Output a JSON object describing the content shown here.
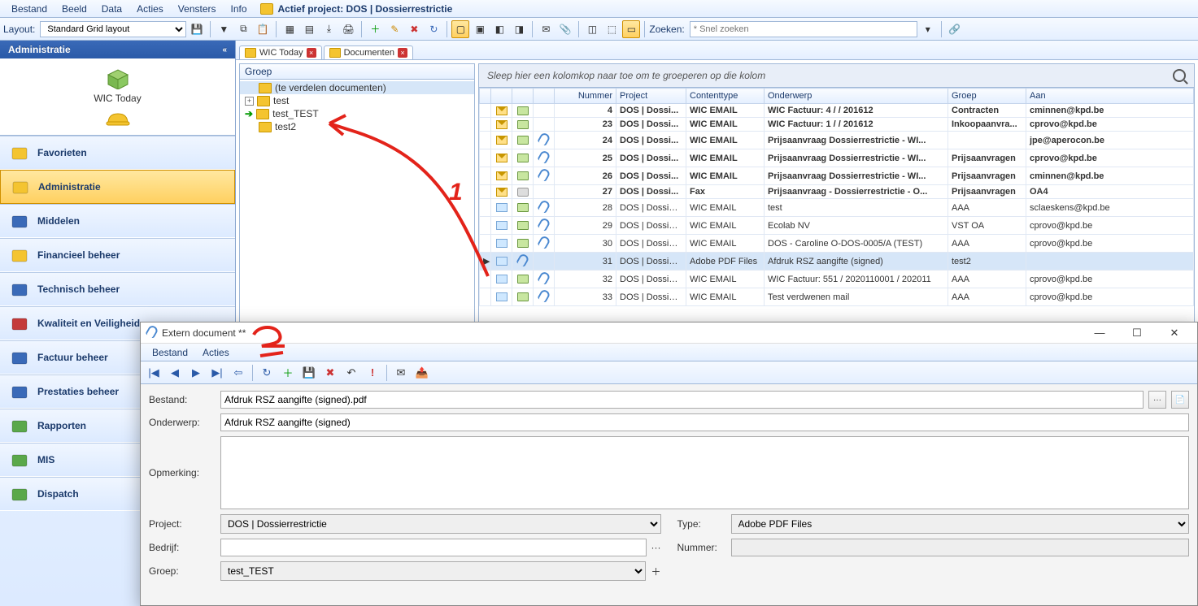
{
  "menu": {
    "items": [
      "Bestand",
      "Beeld",
      "Data",
      "Acties",
      "Vensters",
      "Info"
    ],
    "active_project_lbl": "Actief project: DOS | Dossierrestrictie"
  },
  "toolbar": {
    "layout_lbl": "Layout:",
    "layout_value": "Standard Grid layout",
    "search_lbl": "Zoeken:",
    "search_placeholder": "* Snel zoeken"
  },
  "sidebar": {
    "title": "Administratie",
    "top_label": "WIC Today",
    "items": [
      {
        "label": "Favorieten",
        "iconColor": "#f4c430"
      },
      {
        "label": "Administratie",
        "iconColor": "#f4c430",
        "selected": true
      },
      {
        "label": "Middelen",
        "iconColor": "#3a6ab8"
      },
      {
        "label": "Financieel beheer",
        "iconColor": "#f4c430"
      },
      {
        "label": "Technisch beheer",
        "iconColor": "#3a6ab8"
      },
      {
        "label": "Kwaliteit en Veiligheid",
        "iconColor": "#c43a3a"
      },
      {
        "label": "Factuur beheer",
        "iconColor": "#3a6ab8"
      },
      {
        "label": "Prestaties beheer",
        "iconColor": "#3a6ab8"
      },
      {
        "label": "Rapporten",
        "iconColor": "#5aa84a"
      },
      {
        "label": "MIS",
        "iconColor": "#5aa84a"
      },
      {
        "label": "Dispatch",
        "iconColor": "#5aa84a"
      }
    ]
  },
  "tabs": [
    {
      "label": "WIC Today"
    },
    {
      "label": "Documenten"
    }
  ],
  "tree": {
    "header": "Groep",
    "nodes": [
      {
        "label": "(te verdelen documenten)",
        "selected": true,
        "indent": 0
      },
      {
        "label": "test",
        "indent": 0,
        "exp": "+"
      },
      {
        "label": "test_TEST",
        "indent": 0,
        "arrow": true,
        "hl": true
      },
      {
        "label": "test2",
        "indent": 0
      }
    ]
  },
  "grid": {
    "group_hint": "Sleep hier een kolomkop naar toe om te groeperen op die kolom",
    "columns": [
      "",
      "",
      "",
      "",
      "Nummer",
      "Project",
      "Contenttype",
      "Onderwerp",
      "Groep",
      "Aan"
    ],
    "rows": [
      {
        "bold": true,
        "ic1": "mail",
        "ic2": "fold",
        "att": false,
        "num": "4",
        "proj": "DOS | Dossi...",
        "ct": "WIC EMAIL",
        "ond": "WIC Factuur: 4 /  / 201612",
        "grp": "Contracten",
        "aan": "cminnen@kpd.be"
      },
      {
        "bold": true,
        "ic1": "mail",
        "ic2": "fold",
        "att": false,
        "num": "23",
        "proj": "DOS | Dossi...",
        "ct": "WIC EMAIL",
        "ond": "WIC Factuur: 1 /  / 201612",
        "grp": "Inkoopaanvra...",
        "aan": "cprovo@kpd.be"
      },
      {
        "bold": true,
        "ic1": "mail",
        "ic2": "fold",
        "att": true,
        "num": "24",
        "proj": "DOS | Dossi...",
        "ct": "WIC EMAIL",
        "ond": "Prijsaanvraag Dossierrestrictie - WI...",
        "grp": "",
        "aan": "jpe@aperocon.be"
      },
      {
        "bold": true,
        "ic1": "mail",
        "ic2": "fold",
        "att": true,
        "num": "25",
        "proj": "DOS | Dossi...",
        "ct": "WIC EMAIL",
        "ond": "Prijsaanvraag Dossierrestrictie - WI...",
        "grp": "Prijsaanvragen",
        "aan": "cprovo@kpd.be"
      },
      {
        "bold": true,
        "ic1": "mail",
        "ic2": "fold",
        "att": true,
        "num": "26",
        "proj": "DOS | Dossi...",
        "ct": "WIC EMAIL",
        "ond": "Prijsaanvraag Dossierrestrictie - WI...",
        "grp": "Prijsaanvragen",
        "aan": "cminnen@kpd.be"
      },
      {
        "bold": true,
        "ic1": "mail",
        "ic2": "fax",
        "att": false,
        "num": "27",
        "proj": "DOS | Dossi...",
        "ct": "Fax",
        "ond": "Prijsaanvraag - Dossierrestrictie - O...",
        "grp": "Prijsaanvragen",
        "aan": "OA4"
      },
      {
        "bold": false,
        "ic1": "open",
        "ic2": "fold",
        "att": true,
        "num": "28",
        "proj": "DOS | Dossierr...",
        "ct": "WIC EMAIL",
        "ond": "test",
        "grp": "AAA",
        "aan": "sclaeskens@kpd.be"
      },
      {
        "bold": false,
        "ic1": "open",
        "ic2": "fold",
        "att": true,
        "num": "29",
        "proj": "DOS | Dossierr...",
        "ct": "WIC EMAIL",
        "ond": "Ecolab NV",
        "grp": "VST OA",
        "aan": "cprovo@kpd.be"
      },
      {
        "bold": false,
        "ic1": "open",
        "ic2": "fold",
        "att": true,
        "num": "30",
        "proj": "DOS | Dossierr...",
        "ct": "WIC EMAIL",
        "ond": "DOS - Caroline O-DOS-0005/A (TEST)",
        "grp": "AAA",
        "aan": "cprovo@kpd.be"
      },
      {
        "bold": false,
        "sel": true,
        "ind": "▶",
        "ic1": "open",
        "ic2": "att",
        "att": false,
        "num": "31",
        "proj": "DOS | Dossierr...",
        "ct": "Adobe PDF Files",
        "ond": "Afdruk RSZ aangifte (signed)",
        "grp": "test2",
        "aan": ""
      },
      {
        "bold": false,
        "ic1": "open",
        "ic2": "fold",
        "att": true,
        "num": "32",
        "proj": "DOS | Dossierr...",
        "ct": "WIC EMAIL",
        "ond": "WIC Factuur: 551 / 2020110001 / 202011",
        "grp": "AAA",
        "aan": "cprovo@kpd.be"
      },
      {
        "bold": false,
        "ic1": "open",
        "ic2": "fold",
        "att": true,
        "num": "33",
        "proj": "DOS | Dossierr...",
        "ct": "WIC EMAIL",
        "ond": "Test verdwenen mail",
        "grp": "AAA",
        "aan": "cprovo@kpd.be"
      }
    ]
  },
  "dialog": {
    "title": "Extern document **",
    "menu": [
      "Bestand",
      "Acties"
    ],
    "labels": {
      "bestand": "Bestand:",
      "onderwerp": "Onderwerp:",
      "opmerking": "Opmerking:",
      "project": "Project:",
      "type": "Type:",
      "bedrijf": "Bedrijf:",
      "nummer": "Nummer:",
      "groep": "Groep:"
    },
    "bestand": "Afdruk RSZ aangifte (signed).pdf",
    "onderwerp": "Afdruk RSZ aangifte (signed)",
    "opmerking": "",
    "project": "DOS | Dossierrestrictie",
    "type": "Adobe PDF Files",
    "bedrijf": "",
    "nummer": "",
    "groep": "test_TEST"
  },
  "annotation": {
    "n1": "1",
    "n2": "2"
  }
}
